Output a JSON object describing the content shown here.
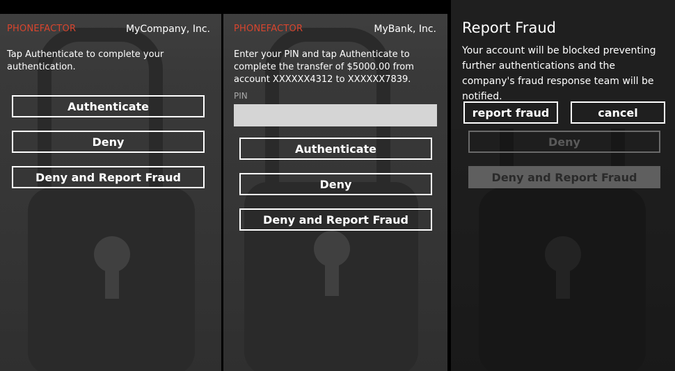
{
  "screens": [
    {
      "brand": "PHONEFACTOR",
      "company": "MyCompany, Inc.",
      "message": "Tap Authenticate to complete your authentication.",
      "buttons": [
        "Authenticate",
        "Deny",
        "Deny and Report Fraud"
      ]
    },
    {
      "brand": "PHONEFACTOR",
      "company": "MyBank, Inc.",
      "message": "Enter your PIN and tap Authenticate to complete the transfer of $5000.00 from account XXXXXX4312 to XXXXXX7839.",
      "pin_label": "PIN",
      "pin_value": "",
      "buttons": [
        "Authenticate",
        "Deny",
        "Deny and Report Fraud"
      ]
    },
    {
      "dialog": {
        "title": "Report Fraud",
        "text": "Your account will be blocked preventing further authentications and the company's fraud response team will be notified.",
        "confirm": "report fraud",
        "cancel": "cancel"
      },
      "background_buttons": [
        "Deny",
        "Deny and Report Fraud"
      ]
    }
  ],
  "colors": {
    "brand": "#d8452e",
    "background": "#393939",
    "pin_field": "#d5d5d5"
  }
}
